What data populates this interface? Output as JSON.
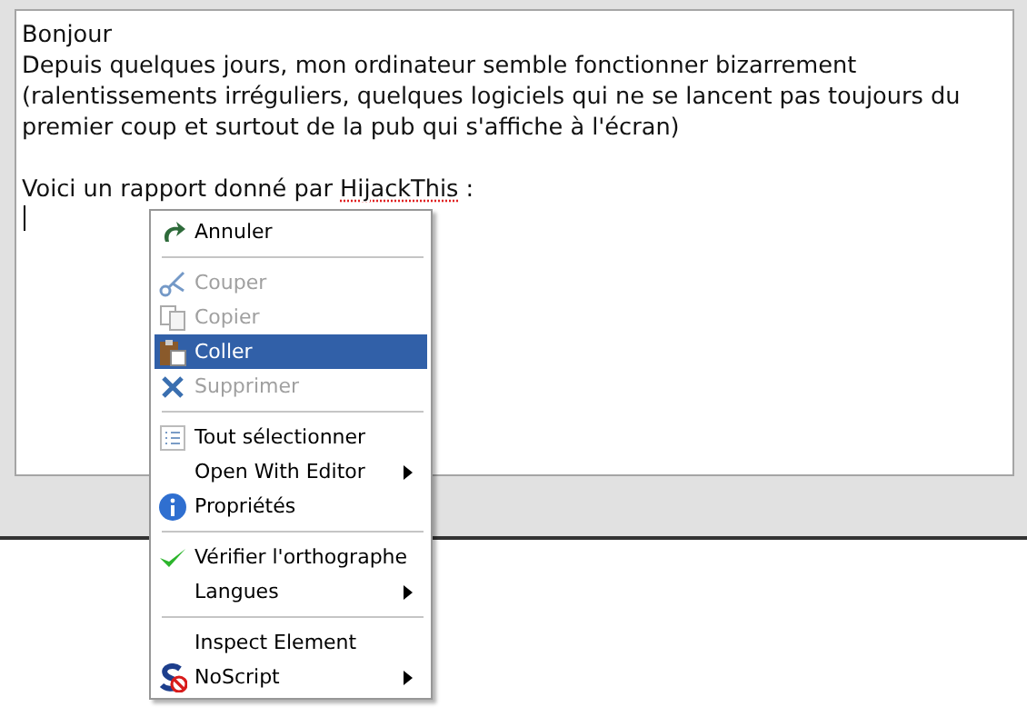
{
  "editor": {
    "lines": [
      [
        {
          "text": "Bonjour",
          "misspelled": false
        }
      ],
      [
        {
          "text": "Depuis quelques jours, mon ordinateur semble fonctionner bizarrement",
          "misspelled": false
        }
      ],
      [
        {
          "text": "(ralentissements irréguliers, quelques logiciels qui ne se lancent pas toujours du",
          "misspelled": false
        }
      ],
      [
        {
          "text": "premier coup et surtout de la pub qui s'affiche à l'écran)",
          "misspelled": false
        }
      ],
      [
        {
          "text": "Voici un rapport donné par ",
          "misspelled": false
        },
        {
          "text": "HijackThis",
          "misspelled": true
        },
        {
          "text": " :",
          "misspelled": false
        }
      ]
    ]
  },
  "context_menu": {
    "items": [
      {
        "kind": "item",
        "label": "Annuler",
        "disabled": false,
        "selected": false,
        "submenu": false
      },
      {
        "kind": "separator"
      },
      {
        "kind": "item",
        "label": "Couper",
        "disabled": true,
        "selected": false,
        "submenu": false
      },
      {
        "kind": "item",
        "label": "Copier",
        "disabled": true,
        "selected": false,
        "submenu": false
      },
      {
        "kind": "item",
        "label": "Coller",
        "disabled": false,
        "selected": true,
        "submenu": false
      },
      {
        "kind": "item",
        "label": "Supprimer",
        "disabled": true,
        "selected": false,
        "submenu": false
      },
      {
        "kind": "separator"
      },
      {
        "kind": "item",
        "label": "Tout sélectionner",
        "disabled": false,
        "selected": false,
        "submenu": false
      },
      {
        "kind": "item",
        "label": "Open With Editor",
        "disabled": false,
        "selected": false,
        "submenu": true
      },
      {
        "kind": "item",
        "label": "Propriétés",
        "disabled": false,
        "selected": false,
        "submenu": false
      },
      {
        "kind": "separator"
      },
      {
        "kind": "item",
        "label": "Vérifier l'orthographe",
        "disabled": false,
        "selected": false,
        "submenu": false
      },
      {
        "kind": "item",
        "label": "Langues",
        "disabled": false,
        "selected": false,
        "submenu": true
      },
      {
        "kind": "separator"
      },
      {
        "kind": "item",
        "label": "Inspect Element",
        "disabled": false,
        "selected": false,
        "submenu": false
      },
      {
        "kind": "item",
        "label": "NoScript",
        "disabled": false,
        "selected": false,
        "submenu": true
      }
    ]
  }
}
